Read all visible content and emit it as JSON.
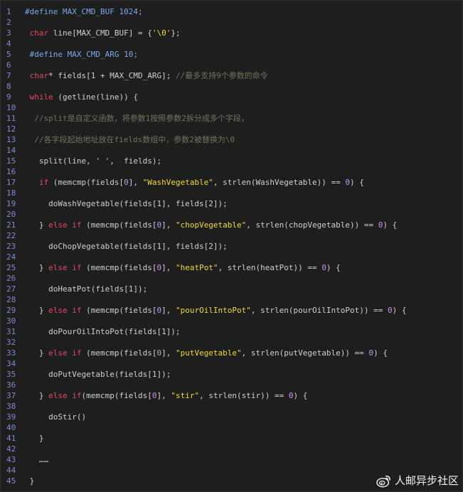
{
  "colors": {
    "background": "#1e1e1e",
    "line_number": "#7b8bd1",
    "keyword": "#dd4a68",
    "preprocessor": "#7fa6e8",
    "string": "#f0d93e",
    "number": "#c792ea",
    "comment": "#75715e",
    "text": "#d0d0d0"
  },
  "lines": [
    {
      "n": "1",
      "indent": "",
      "tokens": [
        [
          "pp",
          "#define MAX_CMD_BUF 1024;"
        ]
      ]
    },
    {
      "n": "2",
      "indent": "",
      "tokens": []
    },
    {
      "n": "3",
      "indent": " ",
      "tokens": [
        [
          "kw",
          "char"
        ],
        [
          "plain",
          " line[MAX_CMD_BUF] = {"
        ],
        [
          "str",
          "'\\0'"
        ],
        [
          "plain",
          "};"
        ]
      ]
    },
    {
      "n": "4",
      "indent": "",
      "tokens": []
    },
    {
      "n": "5",
      "indent": " ",
      "tokens": [
        [
          "pp",
          "#define MAX_CMD_ARG 10;"
        ]
      ]
    },
    {
      "n": "6",
      "indent": "",
      "tokens": []
    },
    {
      "n": "7",
      "indent": " ",
      "tokens": [
        [
          "kw",
          "char"
        ],
        [
          "plain",
          "* fields[1 + MAX_CMD_ARG]; "
        ],
        [
          "cm",
          "//最多支持9个参数的命令"
        ]
      ]
    },
    {
      "n": "8",
      "indent": "",
      "tokens": []
    },
    {
      "n": "9",
      "indent": " ",
      "tokens": [
        [
          "kw",
          "while"
        ],
        [
          "plain",
          " (getline(line)) {"
        ]
      ]
    },
    {
      "n": "10",
      "indent": "",
      "tokens": []
    },
    {
      "n": "11",
      "indent": "  ",
      "tokens": [
        [
          "cm",
          "//split是自定义函数，将参数1按照参数2拆分成多个字段，"
        ]
      ]
    },
    {
      "n": "12",
      "indent": "",
      "tokens": []
    },
    {
      "n": "13",
      "indent": "  ",
      "tokens": [
        [
          "cm",
          "//各字段起始地址放在fields数组中，参数2被替换为\\0"
        ]
      ]
    },
    {
      "n": "14",
      "indent": "",
      "tokens": []
    },
    {
      "n": "15",
      "indent": "   ",
      "tokens": [
        [
          "plain",
          "split(line, "
        ],
        [
          "str",
          "' '"
        ],
        [
          "plain",
          ",  fields);"
        ]
      ]
    },
    {
      "n": "16",
      "indent": "",
      "tokens": []
    },
    {
      "n": "17",
      "indent": "   ",
      "tokens": [
        [
          "kw",
          "if"
        ],
        [
          "plain",
          " (memcmp(fields["
        ],
        [
          "num",
          "0"
        ],
        [
          "plain",
          "], "
        ],
        [
          "str",
          "\"WashVegetable\""
        ],
        [
          "plain",
          ", strlen(WashVegetable)) == "
        ],
        [
          "num",
          "0"
        ],
        [
          "plain",
          ") {"
        ]
      ]
    },
    {
      "n": "18",
      "indent": "",
      "tokens": []
    },
    {
      "n": "19",
      "indent": "     ",
      "tokens": [
        [
          "plain",
          "doWashVegetable(fields[1], fields[2]);"
        ]
      ]
    },
    {
      "n": "20",
      "indent": "",
      "tokens": []
    },
    {
      "n": "21",
      "indent": "   ",
      "tokens": [
        [
          "plain",
          "} "
        ],
        [
          "kw",
          "else if"
        ],
        [
          "plain",
          " (memcmp(fields["
        ],
        [
          "num",
          "0"
        ],
        [
          "plain",
          "], "
        ],
        [
          "str",
          "\"chopVegetable\""
        ],
        [
          "plain",
          ", strlen(chopVegetable)) == "
        ],
        [
          "num",
          "0"
        ],
        [
          "plain",
          ") {"
        ]
      ]
    },
    {
      "n": "22",
      "indent": "",
      "tokens": []
    },
    {
      "n": "23",
      "indent": "     ",
      "tokens": [
        [
          "plain",
          "doChopVegetable(fields[1], fields[2]);"
        ]
      ]
    },
    {
      "n": "24",
      "indent": "",
      "tokens": []
    },
    {
      "n": "25",
      "indent": "   ",
      "tokens": [
        [
          "plain",
          "} "
        ],
        [
          "kw",
          "else if"
        ],
        [
          "plain",
          " (memcmp(fields["
        ],
        [
          "num",
          "0"
        ],
        [
          "plain",
          "], "
        ],
        [
          "str",
          "\"heatPot\""
        ],
        [
          "plain",
          ", strlen(heatPot)) == "
        ],
        [
          "num",
          "0"
        ],
        [
          "plain",
          ") {"
        ]
      ]
    },
    {
      "n": "26",
      "indent": "",
      "tokens": []
    },
    {
      "n": "27",
      "indent": "     ",
      "tokens": [
        [
          "plain",
          "doHeatPot(fields[1]);"
        ]
      ]
    },
    {
      "n": "28",
      "indent": "",
      "tokens": []
    },
    {
      "n": "29",
      "indent": "   ",
      "tokens": [
        [
          "plain",
          "} "
        ],
        [
          "kw",
          "else if"
        ],
        [
          "plain",
          " (memcmp(fields["
        ],
        [
          "num",
          "0"
        ],
        [
          "plain",
          "], "
        ],
        [
          "str",
          "\"pourOilIntoPot\""
        ],
        [
          "plain",
          ", strlen(pourOilIntoPot)) == "
        ],
        [
          "num",
          "0"
        ],
        [
          "plain",
          ") {"
        ]
      ]
    },
    {
      "n": "30",
      "indent": "",
      "tokens": []
    },
    {
      "n": "31",
      "indent": "     ",
      "tokens": [
        [
          "plain",
          "doPourOilIntoPot(fields[1]);"
        ]
      ]
    },
    {
      "n": "32",
      "indent": "",
      "tokens": []
    },
    {
      "n": "33",
      "indent": "   ",
      "tokens": [
        [
          "plain",
          "} "
        ],
        [
          "kw",
          "else if"
        ],
        [
          "plain",
          " (memcmp(fields["
        ],
        [
          "num",
          "0"
        ],
        [
          "plain",
          "], "
        ],
        [
          "str",
          "\"putVegetable\""
        ],
        [
          "plain",
          ", strlen(putVegetable)) == "
        ],
        [
          "num",
          "0"
        ],
        [
          "plain",
          ") {"
        ]
      ]
    },
    {
      "n": "34",
      "indent": "",
      "tokens": []
    },
    {
      "n": "35",
      "indent": "     ",
      "tokens": [
        [
          "plain",
          "doPutVegetable(fields[1]);"
        ]
      ]
    },
    {
      "n": "36",
      "indent": "",
      "tokens": []
    },
    {
      "n": "37",
      "indent": "   ",
      "tokens": [
        [
          "plain",
          "} "
        ],
        [
          "kw",
          "else if"
        ],
        [
          "plain",
          "(memcmp(fields["
        ],
        [
          "num",
          "0"
        ],
        [
          "plain",
          "], "
        ],
        [
          "str",
          "\"stir\""
        ],
        [
          "plain",
          ", strlen(stir)) == "
        ],
        [
          "num",
          "0"
        ],
        [
          "plain",
          ") {"
        ]
      ]
    },
    {
      "n": "38",
      "indent": "",
      "tokens": []
    },
    {
      "n": "39",
      "indent": "     ",
      "tokens": [
        [
          "plain",
          "doStir()"
        ]
      ]
    },
    {
      "n": "40",
      "indent": "",
      "tokens": []
    },
    {
      "n": "41",
      "indent": "   ",
      "tokens": [
        [
          "plain",
          "}"
        ]
      ]
    },
    {
      "n": "42",
      "indent": "",
      "tokens": []
    },
    {
      "n": "43",
      "indent": "   ",
      "tokens": [
        [
          "plain",
          "……"
        ]
      ]
    },
    {
      "n": "44",
      "indent": "",
      "tokens": []
    },
    {
      "n": "45",
      "indent": " ",
      "tokens": [
        [
          "plain",
          "}"
        ]
      ]
    }
  ],
  "watermark": {
    "icon": "weibo-icon",
    "text": "人邮异步社区"
  }
}
